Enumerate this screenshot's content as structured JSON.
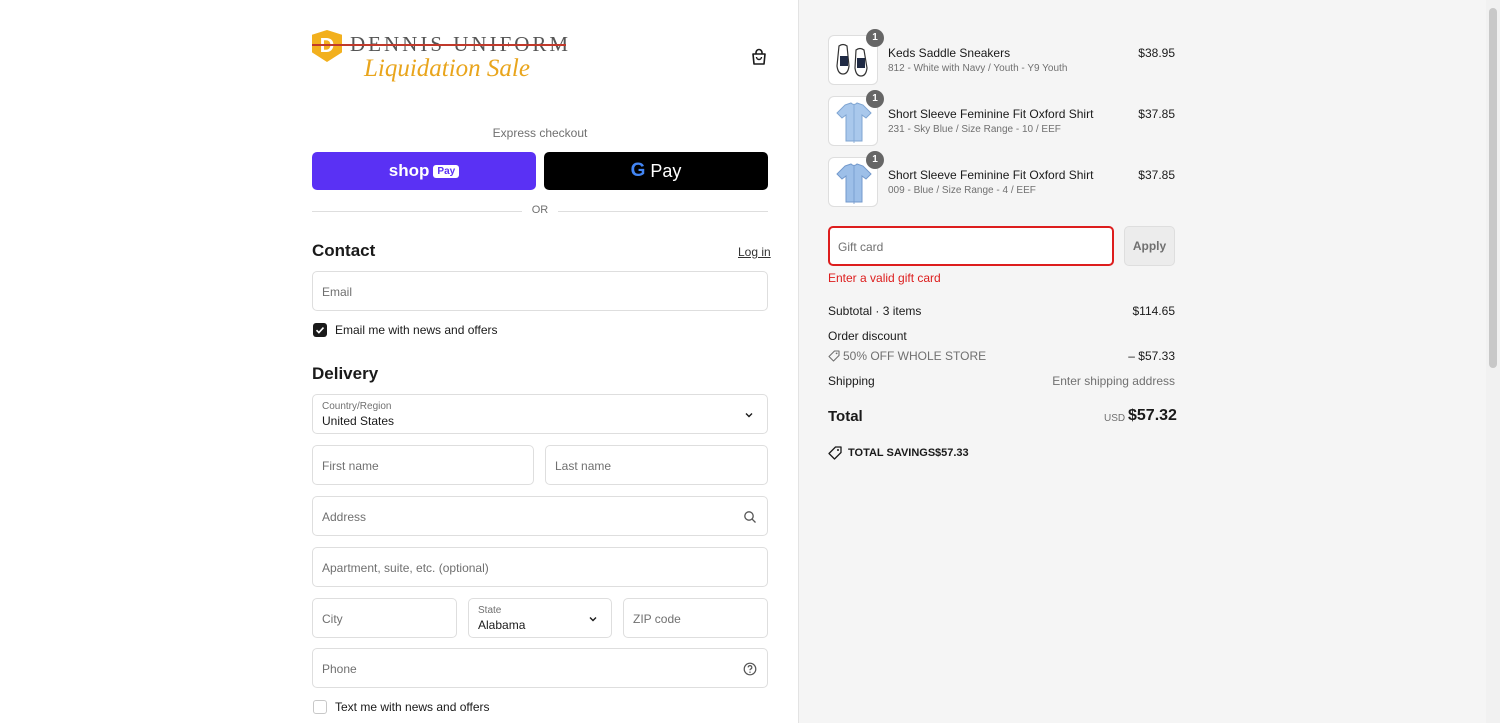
{
  "store": {
    "logo_mark": "D",
    "name": "DENNIS UNIFORM",
    "tagline": "Liquidation Sale"
  },
  "icons": {
    "cart": "shopping-bag-icon",
    "search": "search-icon",
    "help": "question-circle-icon",
    "chevron": "chevron-down-icon",
    "discount": "tag-icon",
    "savings": "price-tag-icon"
  },
  "express": {
    "label": "Express checkout",
    "shop_pay": {
      "text": "shop",
      "badge": "Pay"
    },
    "gpay": {
      "g": "G",
      "text": "Pay"
    },
    "divider": "OR"
  },
  "contact": {
    "heading": "Contact",
    "login": "Log in",
    "email_placeholder": "Email",
    "newsletter_label": "Email me with news and offers",
    "newsletter_checked": true
  },
  "delivery": {
    "heading": "Delivery",
    "country_label": "Country/Region",
    "country_value": "United States",
    "first_name_placeholder": "First name",
    "last_name_placeholder": "Last name",
    "address_placeholder": "Address",
    "apartment_placeholder": "Apartment, suite, etc. (optional)",
    "city_placeholder": "City",
    "state_label": "State",
    "state_value": "Alabama",
    "zip_placeholder": "ZIP code",
    "phone_placeholder": "Phone",
    "sms_label": "Text me with news and offers",
    "sms_checked": false
  },
  "cart": {
    "items": [
      {
        "name": "Keds Saddle Sneakers",
        "variant": "812 - White with Navy / Youth - Y9 Youth",
        "price": "$38.95",
        "qty": "1"
      },
      {
        "name": "Short Sleeve Feminine Fit Oxford Shirt",
        "variant": "231 - Sky Blue / Size Range - 10 / EEF",
        "price": "$37.85",
        "qty": "1"
      },
      {
        "name": "Short Sleeve Feminine Fit Oxford Shirt",
        "variant": "009 - Blue / Size Range - 4 / EEF",
        "price": "$37.85",
        "qty": "1"
      }
    ],
    "gift_placeholder": "Gift card",
    "apply": "Apply",
    "gift_error": "Enter a valid gift card",
    "subtotal_label": "Subtotal · 3 items",
    "subtotal_value": "$114.65",
    "discount_label": "Order discount",
    "discount_code": "50% OFF WHOLE STORE",
    "discount_value": "– $57.33",
    "shipping_label": "Shipping",
    "shipping_value": "Enter shipping address",
    "total_label": "Total",
    "currency": "USD",
    "total_value": "$57.32",
    "savings_label": "TOTAL SAVINGS",
    "savings_value": "$57.33"
  },
  "colors": {
    "shop_pay": "#5a31f4",
    "gpay": "#000000",
    "error": "#dd1d1d",
    "logo_gold": "#e9a51c"
  }
}
